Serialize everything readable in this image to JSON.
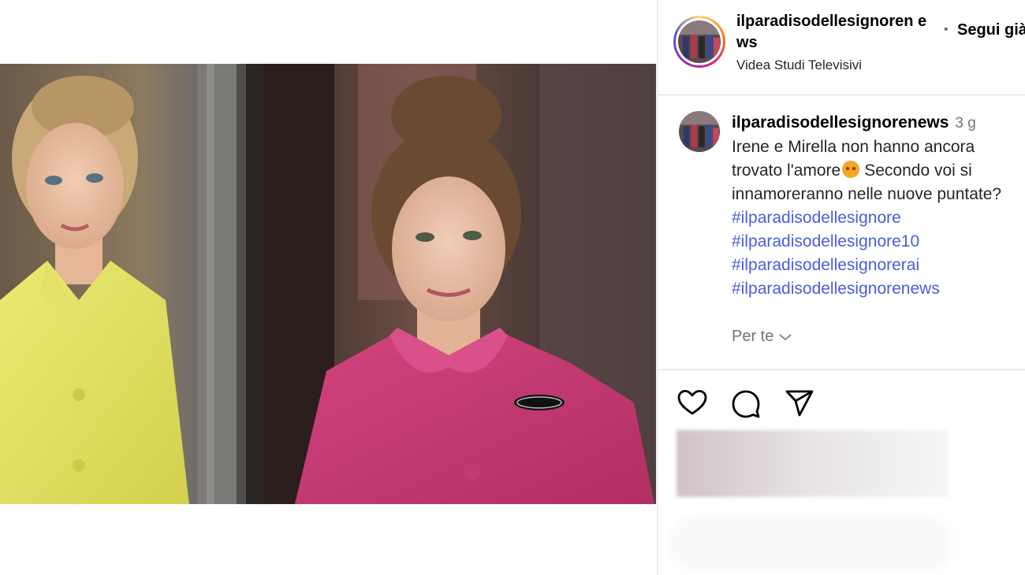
{
  "post": {
    "username": "ilparadisodellesignorenews",
    "username_wrapped": "ilparadisodellesignoren ews",
    "follow_separator": "•",
    "follow_label": "Segui già",
    "location": "Videa Studi Televisivi",
    "image_description_icon": "photo-collage"
  },
  "caption": {
    "username": "ilparadisodellesignorenews",
    "time": "3 g",
    "text_lines": [
      "Irene e Mirella non hanno ancora",
      "trovato l'amore",
      "Secondo voi si",
      "innamoreranno nelle nuove puntate?"
    ],
    "emoji": "pleading-face",
    "hashtags": [
      "#ilparadisodellesignore",
      "#ilparadisodellesignore10",
      "#ilparadisodellesignorerai",
      "#ilparadisodellesignorenews"
    ],
    "see_more": "Per te"
  },
  "actions": {
    "like_icon": "heart-icon",
    "comment_icon": "comment-icon",
    "share_icon": "share-icon"
  },
  "colors": {
    "hashtag": "#4a5de0",
    "border": "#dbdbdb",
    "muted": "#737373"
  }
}
